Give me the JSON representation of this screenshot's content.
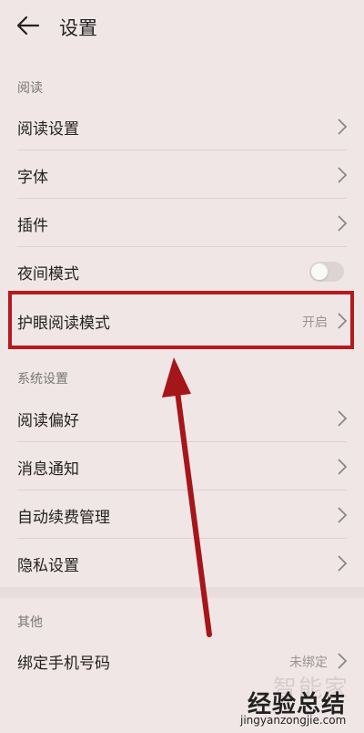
{
  "header": {
    "title": "设置"
  },
  "sections": {
    "reading": "阅读",
    "system": "系统设置",
    "other": "其他"
  },
  "rows": {
    "reading_settings": "阅读设置",
    "font": "字体",
    "plugins": "插件",
    "night_mode": "夜间模式",
    "eye_care": "护眼阅读模式",
    "eye_care_value": "开启",
    "reading_prefs": "阅读偏好",
    "notifications": "消息通知",
    "auto_renew": "自动续费管理",
    "privacy": "隐私设置",
    "bind_phone": "绑定手机号码",
    "bind_phone_value": "未绑定"
  },
  "toggles": {
    "night_mode": false
  },
  "colors": {
    "highlight": "#b41a1e",
    "background": "#f1e6e6"
  },
  "watermark": {
    "line1": "智能家",
    "line2": "经验总结",
    "line3": "jingyanzongjie.com"
  }
}
